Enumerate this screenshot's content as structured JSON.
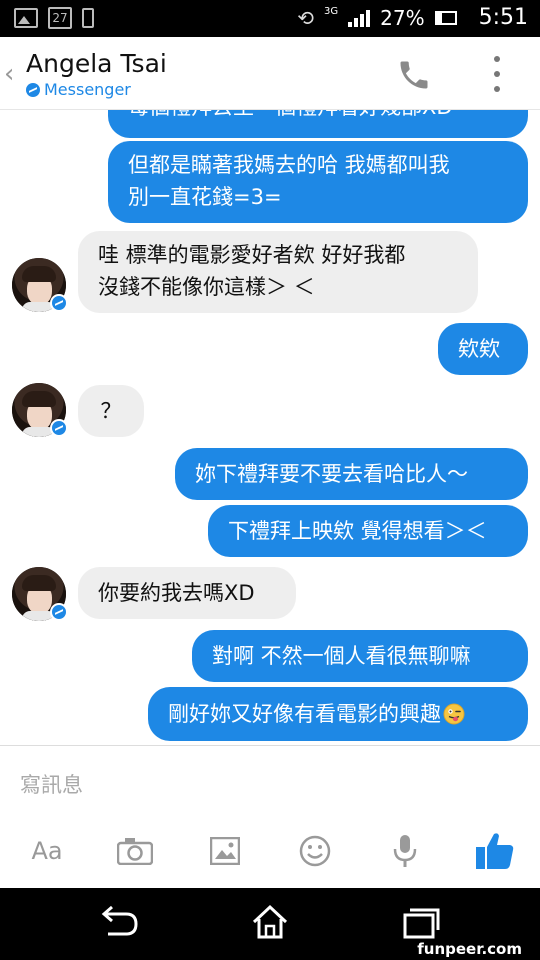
{
  "status_bar": {
    "calendar_day": "27",
    "network": "3G",
    "battery": "27%",
    "time": "5:51"
  },
  "header": {
    "contact_name": "Angela Tsai",
    "subtitle": "Messenger"
  },
  "messages": [
    {
      "side": "out",
      "text": "每個禮拜去至一個禮拜看好幾部XD"
    },
    {
      "side": "out",
      "lines": [
        "但都是瞞著我媽去的哈 我媽都叫我",
        "別一直花錢=3="
      ]
    },
    {
      "side": "in",
      "lines": [
        "哇 標準的電影愛好者欸 好好我都",
        "沒錢不能像你這樣＞ ＜"
      ]
    },
    {
      "side": "out",
      "text": "欸欸"
    },
    {
      "side": "in",
      "text": "？"
    },
    {
      "side": "out",
      "text": "妳下禮拜要不要去看哈比人～"
    },
    {
      "side": "out",
      "text": "下禮拜上映欸 覺得想看＞＜"
    },
    {
      "side": "in",
      "text": "你要約我去嗎XD"
    },
    {
      "side": "out",
      "text": "對啊 不然一個人看很無聊嘛"
    },
    {
      "side": "out",
      "text": "剛好妳又好像有看電影的興趣"
    }
  ],
  "composer": {
    "placeholder": "寫訊息",
    "text_format_label": "Aa"
  },
  "icons": {
    "camera": "camera-icon",
    "gallery": "image-icon",
    "emoji": "emoji-icon",
    "mic": "microphone-icon",
    "like": "thumbs-up-icon"
  },
  "watermark": "funpeer.com",
  "colors": {
    "accent": "#1e88e5",
    "incoming_bubble": "#eeeeee",
    "outgoing_text": "#ffffff"
  }
}
